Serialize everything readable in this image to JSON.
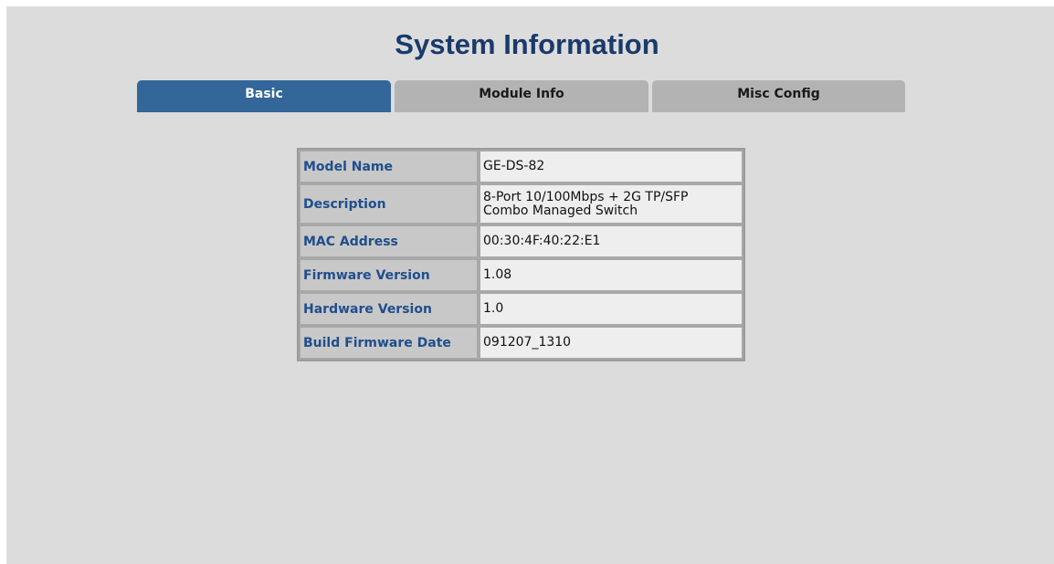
{
  "page": {
    "title": "System Information"
  },
  "tabs": [
    {
      "label": "Basic",
      "active": true
    },
    {
      "label": "Module Info",
      "active": false
    },
    {
      "label": "Misc Config",
      "active": false
    }
  ],
  "info": {
    "rows": [
      {
        "label": "Model Name",
        "value": "GE-DS-82"
      },
      {
        "label": "Description",
        "value_line1": "8-Port 10/100Mbps + 2G TP/SFP",
        "value_line2": "Combo Managed Switch"
      },
      {
        "label": "MAC Address",
        "value": "00:30:4F:40:22:E1"
      },
      {
        "label": "Firmware Version",
        "value": "1.08"
      },
      {
        "label": "Hardware Version",
        "value": "1.0"
      },
      {
        "label": "Build Firmware Date",
        "value": "091207_1310"
      }
    ]
  },
  "colors": {
    "active_tab": "#336699",
    "inactive_tab": "#b3b3b3",
    "label_text": "#1f4e8c",
    "title_text": "#1a3a6b",
    "background": "#dcdcdc"
  }
}
